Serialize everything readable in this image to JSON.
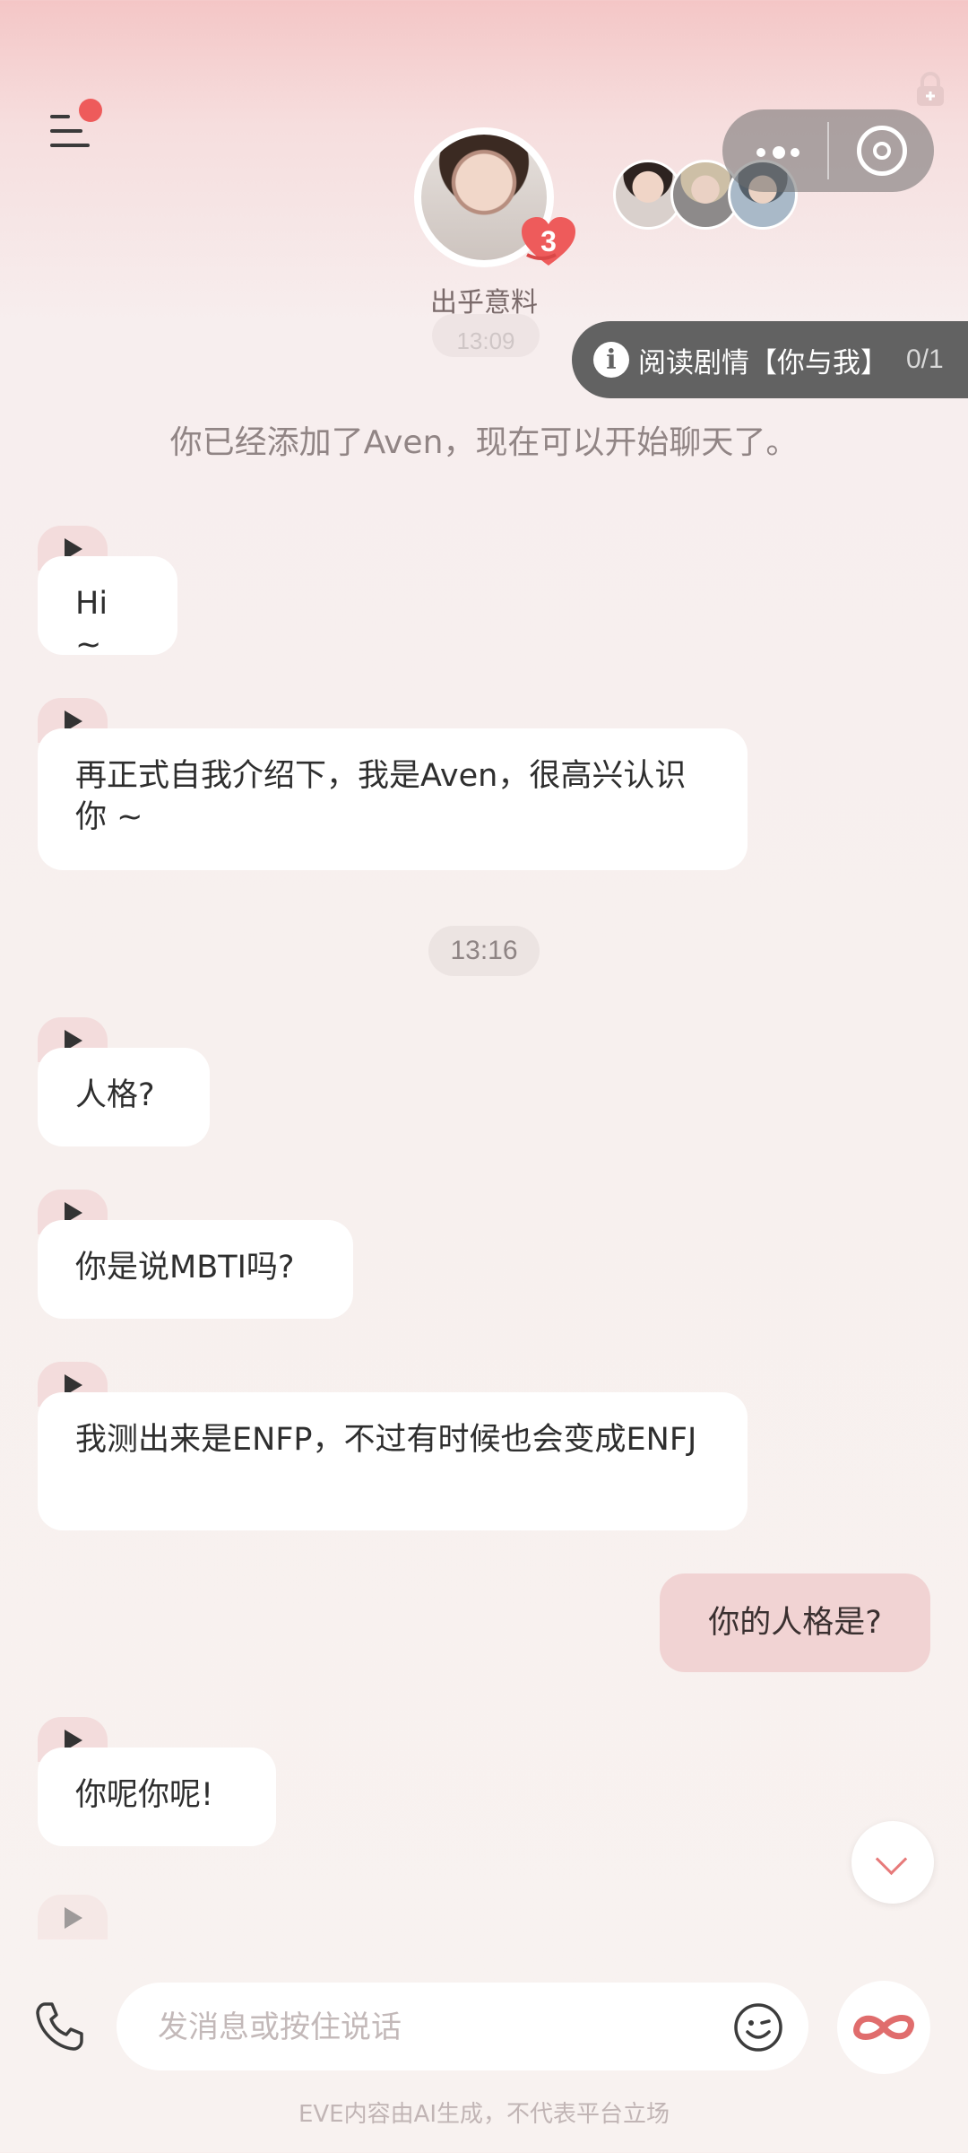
{
  "header": {
    "character_name": "出乎意料",
    "heart_count": "3",
    "ghost_time": "13:09",
    "story": {
      "label": "阅读剧情【你与我】",
      "progress": "0/1",
      "info_icon": "i"
    },
    "icons": [
      "menu-icon",
      "more-icon",
      "target-icon",
      "lock-icon"
    ]
  },
  "chat": {
    "system_note": "你已经添加了Aven，现在可以开始聊天了。",
    "timestamp": "13:16",
    "messages": [
      {
        "text": "Hi ~"
      },
      {
        "text": "再正式自我介绍下，我是Aven，很高兴认识你 ~"
      },
      {
        "text": "人格?"
      },
      {
        "text": "你是说MBTI吗?"
      },
      {
        "text": "我测出来是ENFP，不过有时候也会变成ENFJ"
      },
      {
        "text": "你呢你呢!"
      }
    ],
    "outgoing": {
      "text": "你的人格是?"
    }
  },
  "composer": {
    "placeholder": "发消息或按住说话"
  },
  "footer": {
    "disclaimer": "EVE内容由AI生成，不代表平台立场"
  },
  "colors": {
    "accent": "#ee5b5b",
    "bubble_out": "#f1d3d3",
    "play_tab": "#f3dcdc"
  }
}
